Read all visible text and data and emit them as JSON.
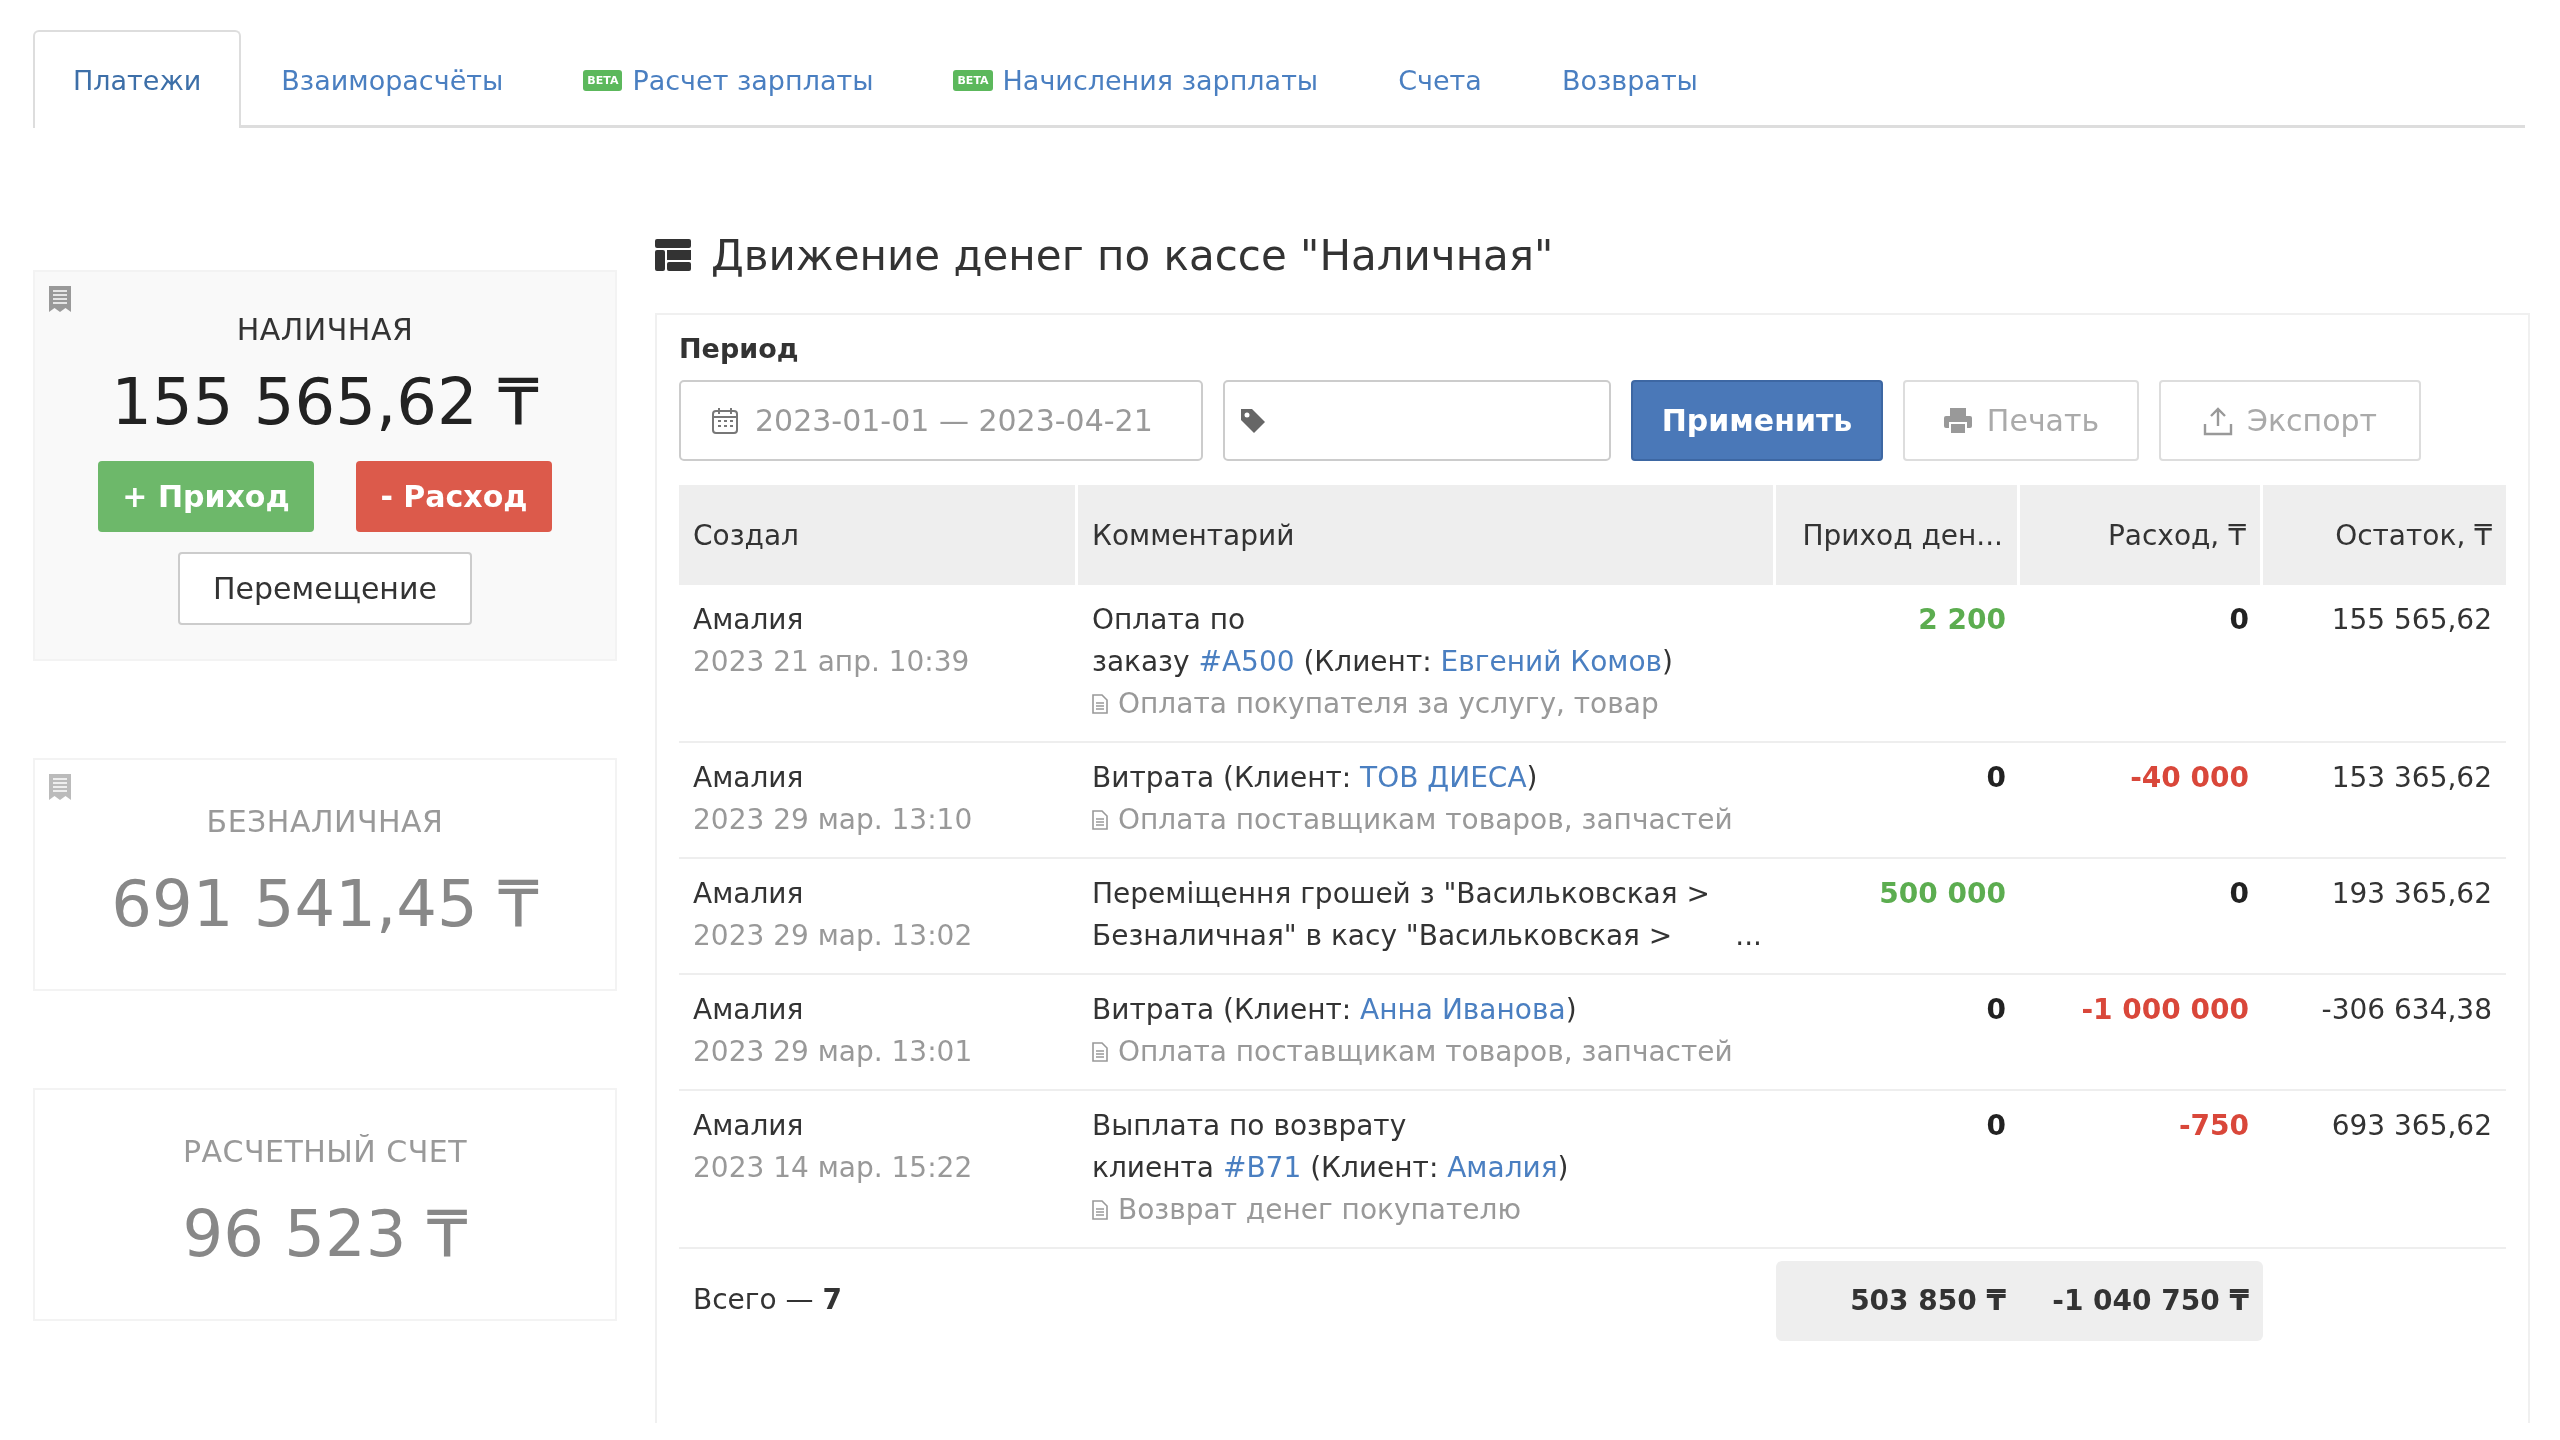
{
  "tabs": [
    {
      "label": "Платежи",
      "selected": true
    },
    {
      "label": "Взаиморасчёты",
      "selected": false
    },
    {
      "label": "Расчет зарплаты",
      "badge": "BETA",
      "selected": false
    },
    {
      "label": "Начисления зарплаты",
      "badge": "BETA",
      "selected": false
    },
    {
      "label": "Счета",
      "selected": false
    },
    {
      "label": "Возвраты",
      "selected": false
    }
  ],
  "registers": [
    {
      "name": "НАЛИЧНАЯ",
      "amount": "155 565,62 ₸",
      "selected": true,
      "receipt_icon": true,
      "income_button": "+ Приход",
      "expense_button": "- Расход",
      "transfer_button": "Перемещение"
    },
    {
      "name": "БЕЗНАЛИЧНАЯ",
      "amount": "691 541,45 ₸",
      "selected": false,
      "receipt_icon": true
    },
    {
      "name": "РАСЧЕТНЫЙ СЧЕТ",
      "amount": "96 523 ₸",
      "selected": false,
      "receipt_icon": false
    }
  ],
  "title": "Движение денег по кассе \"Наличная\"",
  "filters": {
    "period_label": "Период",
    "period_value": "2023-01-01 — 2023-04-21",
    "apply_button": "Применить",
    "print_button": "Печать",
    "export_button": "Экспорт"
  },
  "table": {
    "columns": [
      "Создал",
      "Комментарий",
      "Приход ден...",
      "Расход, ₸",
      "Остаток, ₸"
    ],
    "rows": [
      {
        "author": "Амалия",
        "date": "2023 21 апр. 10:39",
        "comment": [
          [
            {
              "kind": "text",
              "text": "Оплата по"
            }
          ],
          [
            {
              "kind": "text",
              "text": "заказу "
            },
            {
              "kind": "link",
              "text": "#A500"
            },
            {
              "kind": "text",
              "text": " (Клиент: "
            },
            {
              "kind": "link",
              "text": "Евгений Комов"
            },
            {
              "kind": "text",
              "text": ")"
            }
          ]
        ],
        "note": "Оплата покупателя за услугу, товар",
        "income": {
          "text": "2 200",
          "kind": "positive"
        },
        "expense": {
          "text": "0",
          "kind": "zero"
        },
        "balance": "155 565,62"
      },
      {
        "author": "Амалия",
        "date": "2023 29 мар. 13:10",
        "comment": [
          [
            {
              "kind": "text",
              "text": "Витрата  (Клиент: "
            },
            {
              "kind": "link",
              "text": "ТОВ ДИЕСА"
            },
            {
              "kind": "text",
              "text": ")"
            }
          ]
        ],
        "note": "Оплата поставщикам товаров, запчастей",
        "income": {
          "text": "0",
          "kind": "zero"
        },
        "expense": {
          "text": "-40 000",
          "kind": "negative"
        },
        "balance": "153 365,62"
      },
      {
        "author": "Амалия",
        "date": "2023 29 мар. 13:02",
        "comment": [
          [
            {
              "kind": "text",
              "text": "Переміщення грошей з \"Васильковская >"
            }
          ],
          [
            {
              "kind": "text",
              "text": "Безналичная\" в касу \"Васильковская >"
            }
          ]
        ],
        "more": "...",
        "income": {
          "text": "500 000",
          "kind": "positive"
        },
        "expense": {
          "text": "0",
          "kind": "zero"
        },
        "balance": "193 365,62"
      },
      {
        "author": "Амалия",
        "date": "2023 29 мар. 13:01",
        "comment": [
          [
            {
              "kind": "text",
              "text": "Витрата  (Клиент: "
            },
            {
              "kind": "link",
              "text": "Анна Иванова"
            },
            {
              "kind": "text",
              "text": ")"
            }
          ]
        ],
        "note": "Оплата поставщикам товаров, запчастей",
        "income": {
          "text": "0",
          "kind": "zero"
        },
        "expense": {
          "text": "-1 000 000",
          "kind": "negative"
        },
        "balance": "-306 634,38"
      },
      {
        "author": "Амалия",
        "date": "2023 14 мар. 15:22",
        "comment": [
          [
            {
              "kind": "text",
              "text": "Выплата по возврату"
            }
          ],
          [
            {
              "kind": "text",
              "text": "клиента "
            },
            {
              "kind": "link",
              "text": "#B71"
            },
            {
              "kind": "text",
              "text": " (Клиент: "
            },
            {
              "kind": "link",
              "text": "Амалия"
            },
            {
              "kind": "text",
              "text": ")"
            }
          ]
        ],
        "note": "Возврат денег покупателю",
        "income": {
          "text": "0",
          "kind": "zero"
        },
        "expense": {
          "text": "-750",
          "kind": "negative"
        },
        "balance": "693 365,62"
      }
    ],
    "footer": {
      "count": "Всего — **7**",
      "income_total": "503 850 ₸",
      "expense_total": "-1 040 750 ₸"
    }
  }
}
